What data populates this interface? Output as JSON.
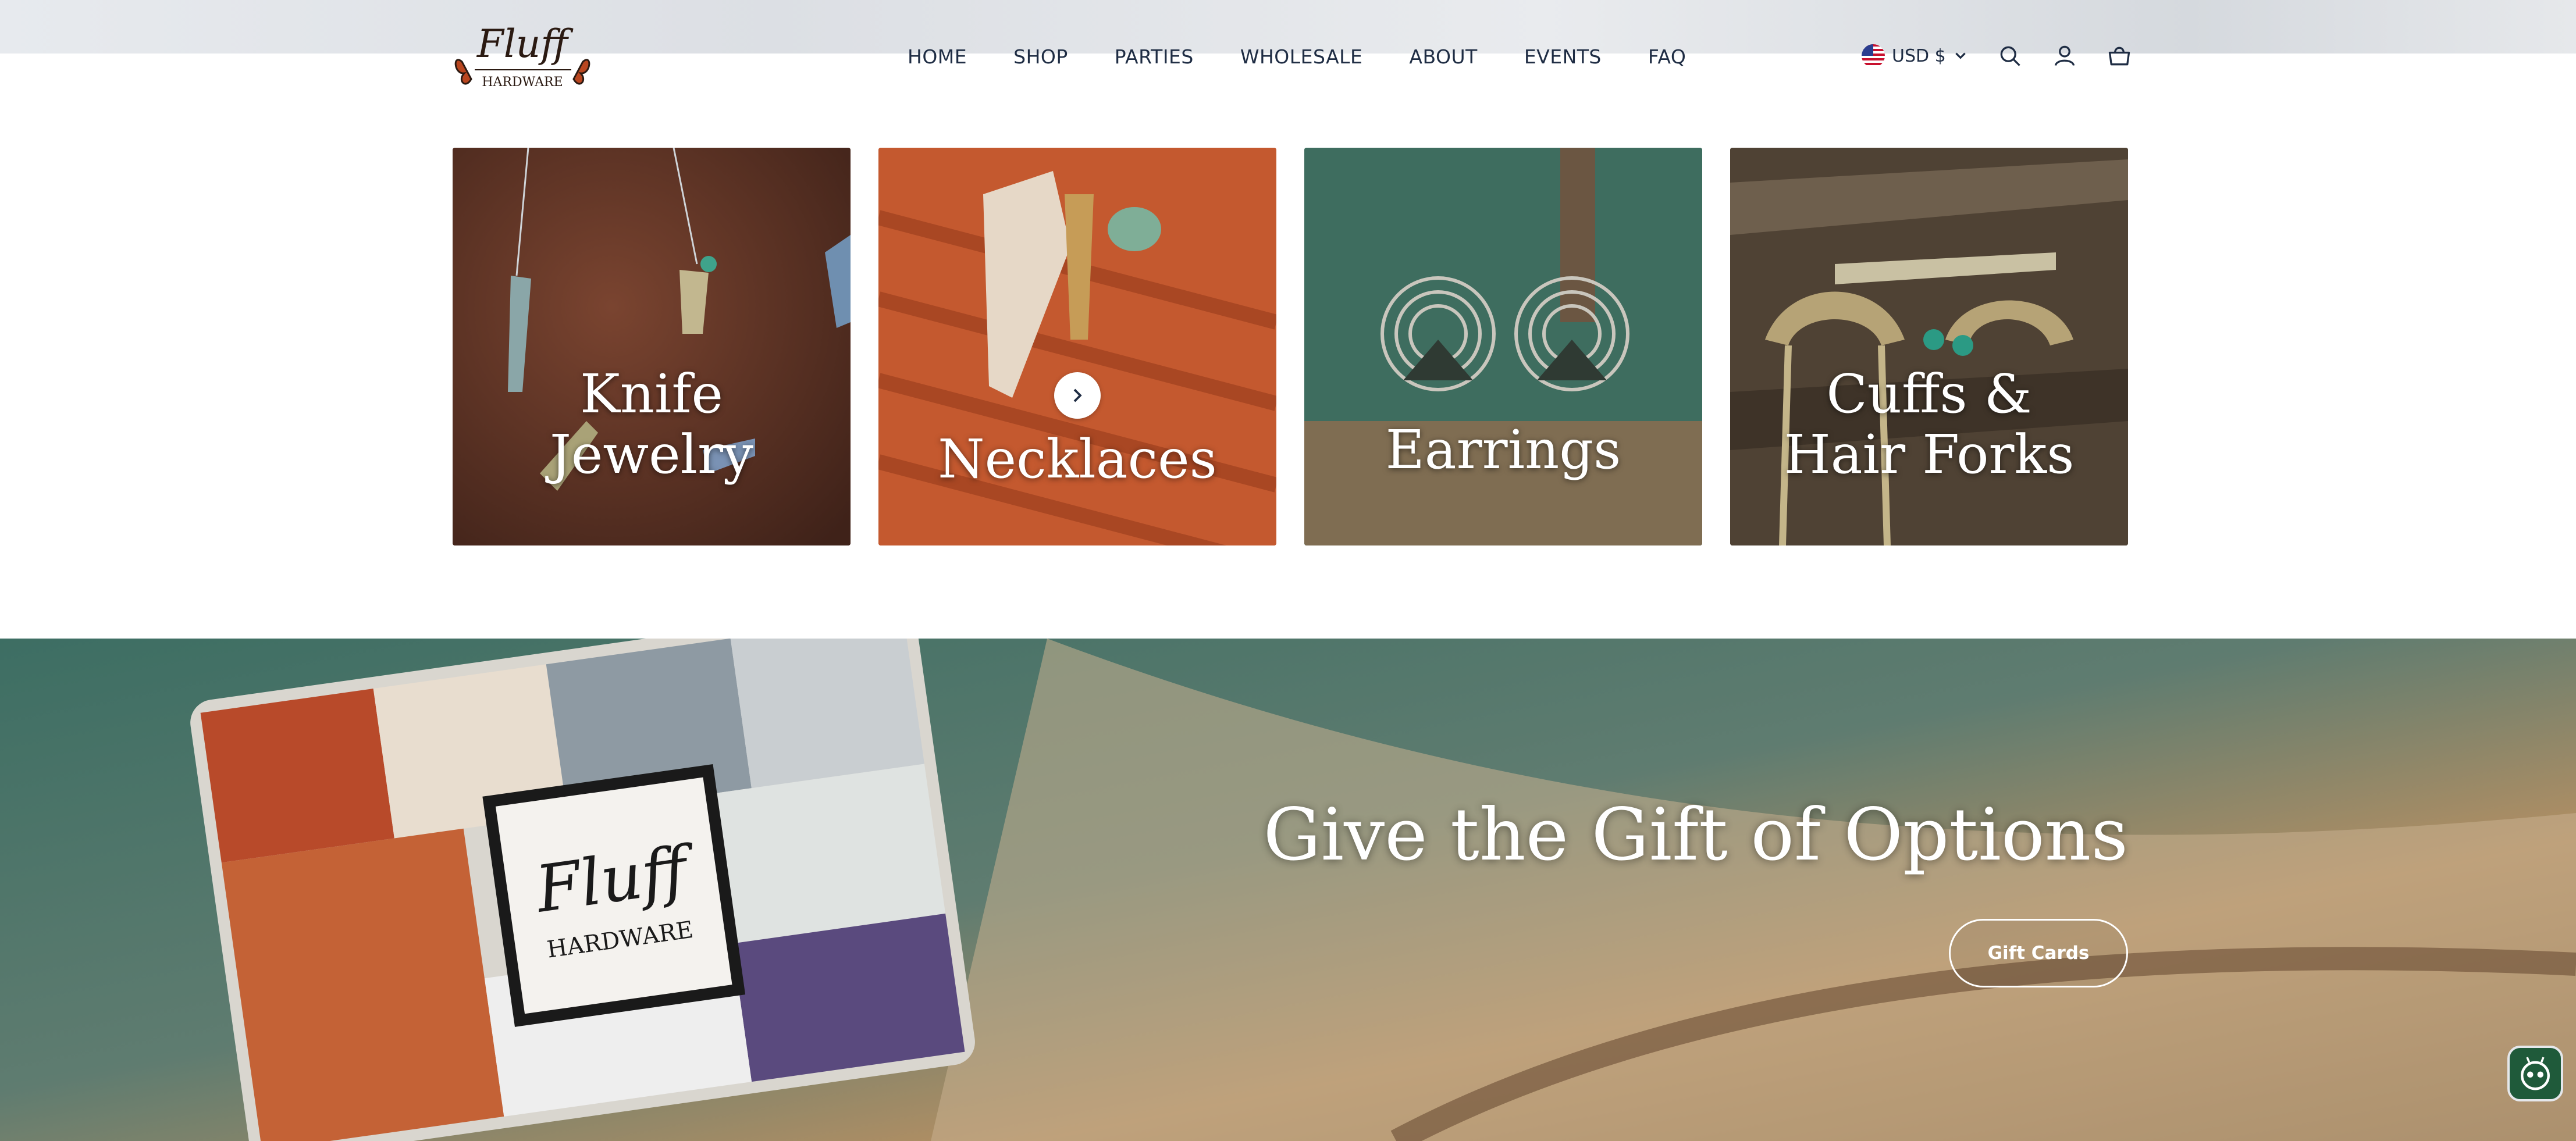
{
  "brand": {
    "logo_word": "Fluff",
    "logo_sub": "HARDWARE"
  },
  "nav": {
    "items": [
      "HOME",
      "SHOP",
      "PARTIES",
      "WHOLESALE",
      "ABOUT",
      "EVENTS",
      "FAQ"
    ]
  },
  "header": {
    "currency": "USD $",
    "icons": [
      "us-flag-icon",
      "chevron-down-icon",
      "search-icon",
      "account-icon",
      "cart-icon"
    ]
  },
  "categories": [
    {
      "title": "Knife\nJewelry"
    },
    {
      "title": "Necklaces"
    },
    {
      "title": "Earrings"
    },
    {
      "title": "Cuffs &\nHair Forks"
    }
  ],
  "banner": {
    "title": "Give the Gift of Options",
    "button_label": "Gift Cards",
    "card_logo_word": "Fluff",
    "card_logo_sub": "HARDWARE"
  },
  "colors": {
    "nav_text": "#1f2d44",
    "chat_widget": "#1f5a3a"
  }
}
